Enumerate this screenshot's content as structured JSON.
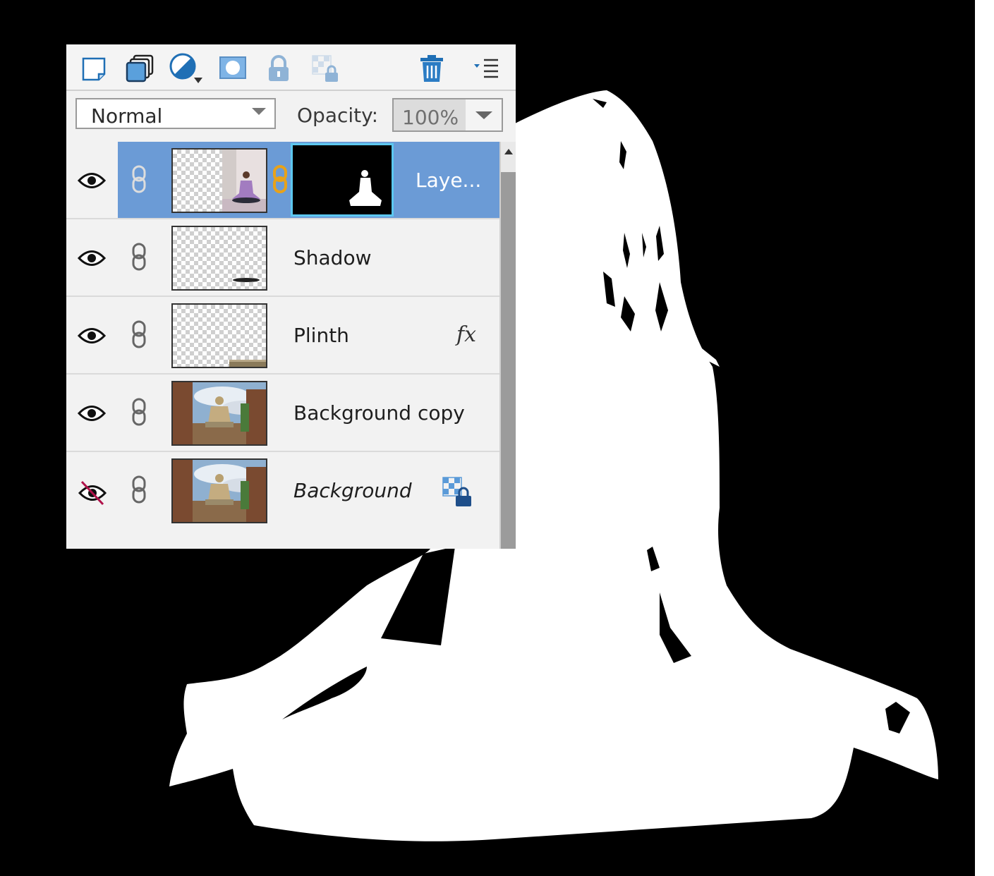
{
  "toolbar": {
    "buttons": [
      {
        "icon": "new-layer-icon"
      },
      {
        "icon": "new-group-icon"
      },
      {
        "icon": "adjustment-layer-icon"
      },
      {
        "icon": "add-mask-icon"
      },
      {
        "icon": "lock-all-icon"
      },
      {
        "icon": "lock-transparency-icon"
      },
      {
        "icon": "trash-icon"
      },
      {
        "icon": "panel-menu-icon"
      }
    ]
  },
  "options": {
    "blend_mode": "Normal",
    "opacity_label": "Opacity:",
    "opacity_value": "100%"
  },
  "layers": [
    {
      "name": "Laye...",
      "visible": true,
      "selected": true,
      "has_mask": true,
      "thumb": "yoga-woman-photo"
    },
    {
      "name": "Shadow",
      "visible": true,
      "selected": false,
      "thumb": "transparent-shadow"
    },
    {
      "name": "Plinth",
      "visible": true,
      "selected": false,
      "fx": "fx",
      "thumb": "transparent-plinth"
    },
    {
      "name": "Background copy",
      "visible": true,
      "selected": false,
      "thumb": "temple-buddha-photo"
    },
    {
      "name": "Background",
      "visible": false,
      "selected": false,
      "italic": true,
      "locked": true,
      "thumb": "temple-buddha-photo"
    }
  ],
  "colors": {
    "selection": "#6b9bd6",
    "mask_border": "#5cc8f0",
    "chain_link_active": "#e8a21a",
    "hidden_eye_slash": "#b0124a"
  }
}
